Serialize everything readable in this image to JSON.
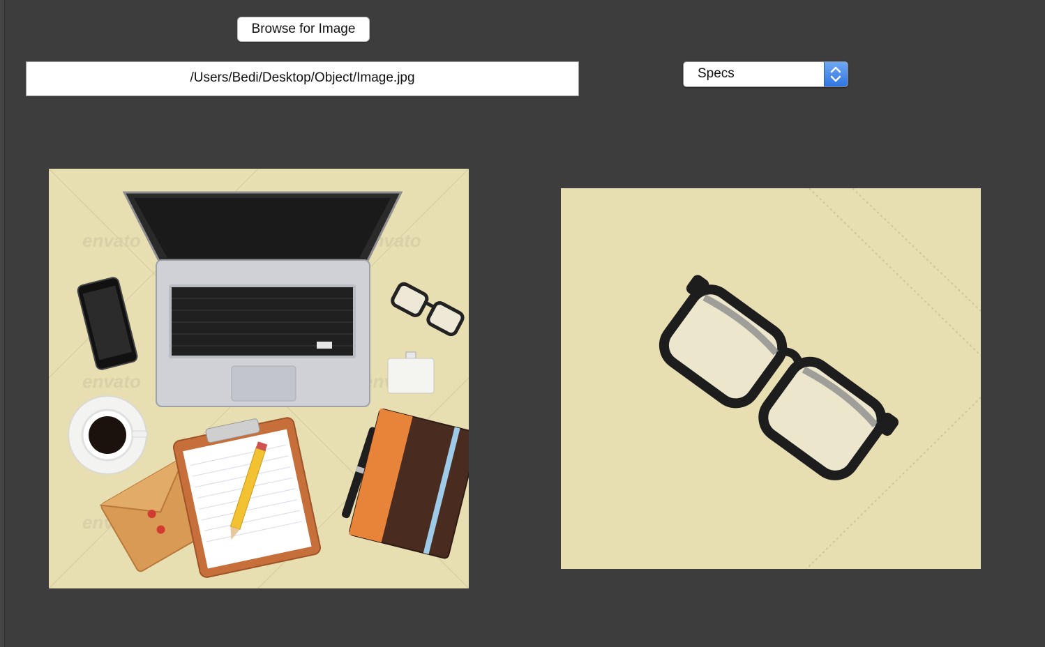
{
  "toolbar": {
    "browse_label": "Browse for Image"
  },
  "file_path": {
    "value": "/Users/Bedi/Desktop/Object/Image.jpg"
  },
  "object_select": {
    "selected": "Specs"
  },
  "input_image": {
    "description_icon": "desk-scene-image",
    "watermark_text": "envato"
  },
  "output_image": {
    "description_icon": "glasses-crop-image"
  },
  "colors": {
    "background": "#3d3d3d",
    "image_background": "#e7deb2",
    "select_accent": "#2f75e1"
  }
}
